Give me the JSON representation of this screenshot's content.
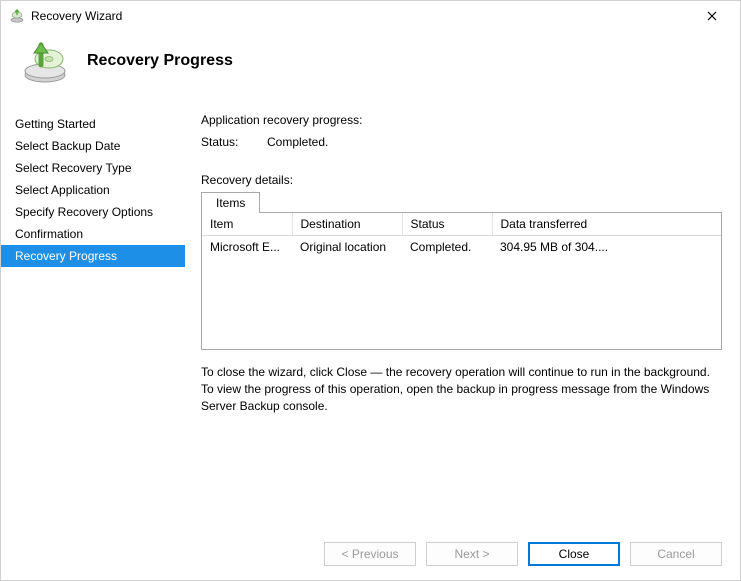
{
  "window": {
    "title": "Recovery Wizard"
  },
  "header": {
    "heading": "Recovery Progress"
  },
  "sidebar": {
    "steps": [
      {
        "label": "Getting Started"
      },
      {
        "label": "Select Backup Date"
      },
      {
        "label": "Select Recovery Type"
      },
      {
        "label": "Select Application"
      },
      {
        "label": "Specify Recovery Options"
      },
      {
        "label": "Confirmation"
      },
      {
        "label": "Recovery Progress"
      }
    ],
    "selected_index": 6
  },
  "main": {
    "progress_title": "Application recovery progress:",
    "status_label": "Status:",
    "status_value": "Completed.",
    "details_label": "Recovery details:",
    "tab_label": "Items",
    "columns": {
      "item": "Item",
      "destination": "Destination",
      "status": "Status",
      "data": "Data transferred"
    },
    "rows": [
      {
        "item": "Microsoft E...",
        "destination": "Original location",
        "status": "Completed.",
        "data": "304.95 MB of 304...."
      }
    ],
    "hint": "To close the wizard, click Close — the recovery operation will continue to run in the background. To view the progress of this operation, open the backup in progress message from the Windows Server Backup console."
  },
  "buttons": {
    "previous": "< Previous",
    "next": "Next >",
    "close": "Close",
    "cancel": "Cancel"
  }
}
